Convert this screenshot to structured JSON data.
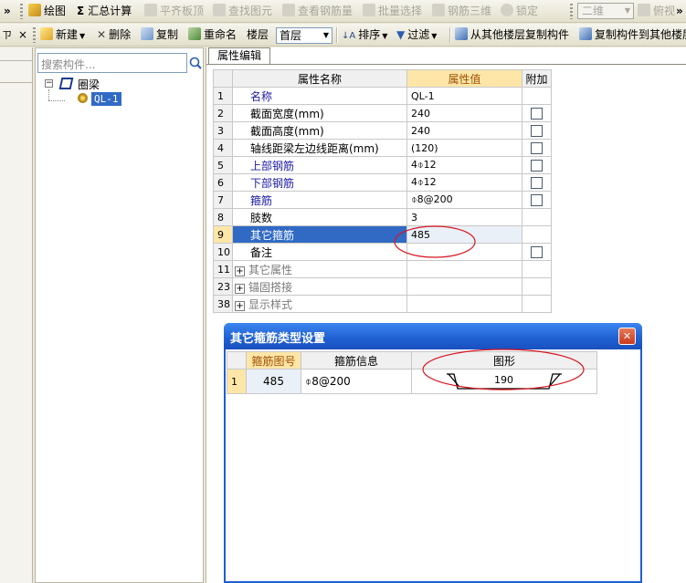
{
  "toolbar1": {
    "overflow_left": "»",
    "draw": "绘图",
    "sum_calc": "汇总计算",
    "level_slab_top": "平齐板顶",
    "find_element": "查找图元",
    "view_rebar": "查看钢筋量",
    "batch_select": "批量选择",
    "rebar_3d": "钢筋三维",
    "lock": "锁定",
    "view_mode": "二维",
    "view_angle": "俯视",
    "overflow_right": "»"
  },
  "toolbar2": {
    "pin": "ㄗ",
    "close": "×",
    "new": "新建",
    "delete": "删除",
    "copy": "复制",
    "rename": "重命名",
    "floor_label": "楼层",
    "floor_value": "首层",
    "sort": "排序",
    "filter": "过滤",
    "copy_from_floor": "从其他楼层复制构件",
    "copy_to_floor": "复制构件到其他楼层"
  },
  "tree": {
    "search_placeholder": "搜索构件...",
    "root": "圈梁",
    "root_toggle": "−",
    "child": "QL-1"
  },
  "props": {
    "tab": "属性编辑",
    "headers": [
      "属性名称",
      "属性值",
      "附加"
    ],
    "rows": [
      {
        "no": "1",
        "name": "名称",
        "value": "QL-1",
        "style": "blue",
        "check": false
      },
      {
        "no": "2",
        "name": "截面宽度(mm)",
        "value": "240",
        "style": "normal",
        "check": true
      },
      {
        "no": "3",
        "name": "截面高度(mm)",
        "value": "240",
        "style": "normal",
        "check": true
      },
      {
        "no": "4",
        "name": "轴线距梁左边线距离(mm)",
        "value": "(120)",
        "style": "normal",
        "check": true
      },
      {
        "no": "5",
        "name": "上部钢筋",
        "value": "4⌽12",
        "style": "blue",
        "check": true
      },
      {
        "no": "6",
        "name": "下部钢筋",
        "value": "4⌽12",
        "style": "blue",
        "check": true
      },
      {
        "no": "7",
        "name": "箍筋",
        "value": "⌽8@200",
        "style": "blue",
        "check": true
      },
      {
        "no": "8",
        "name": "肢数",
        "value": "3",
        "style": "normal",
        "check": false
      },
      {
        "no": "9",
        "name": "其它箍筋",
        "value": "485",
        "style": "selected",
        "check": false
      },
      {
        "no": "10",
        "name": "备注",
        "value": "",
        "style": "normal",
        "check": true
      },
      {
        "no": "11",
        "name": "其它属性",
        "value": "",
        "style": "group",
        "check": false
      },
      {
        "no": "23",
        "name": "锚固搭接",
        "value": "",
        "style": "group",
        "check": false
      },
      {
        "no": "38",
        "name": "显示样式",
        "value": "",
        "style": "group",
        "check": false
      }
    ]
  },
  "dialog": {
    "title": "其它箍筋类型设置",
    "close": "✕",
    "headers": [
      "箍筋图号",
      "箍筋信息",
      "图形"
    ],
    "row": {
      "no": "1",
      "code": "485",
      "info": "⌽8@200",
      "shape_value": "190"
    }
  },
  "colors": {
    "selected_row": "#316ac5",
    "header_value_bg": "#fde6a8",
    "dialog_title": "#1f5fd0",
    "annotation": "#d8141e"
  }
}
